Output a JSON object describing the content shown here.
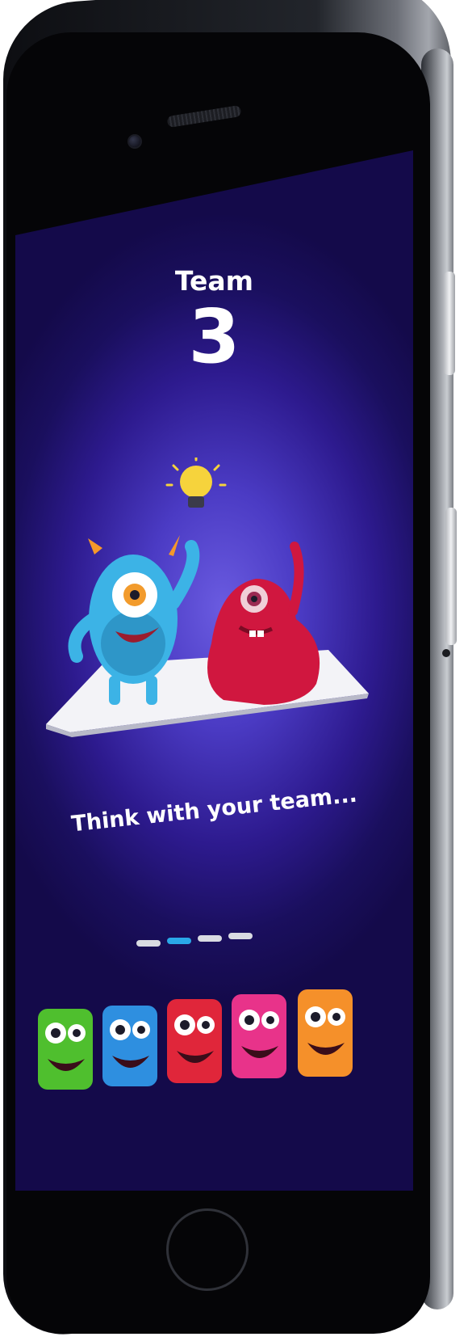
{
  "screen": {
    "team_label": "Team",
    "team_number": "3",
    "caption": "Think with your team...",
    "illustration_icon": "lightbulb-icon"
  },
  "pager": {
    "page_count": 4,
    "active_index": 1,
    "active_color": "#2aa8e8",
    "inactive_color": "#d9dbe2"
  },
  "avatars": [
    {
      "name": "green-monster",
      "color": "#4fbf2e"
    },
    {
      "name": "blue-monster",
      "color": "#2e8fe0"
    },
    {
      "name": "red-monster",
      "color": "#e0263a"
    },
    {
      "name": "pink-monster",
      "color": "#e8338a"
    },
    {
      "name": "orange-monster",
      "color": "#f5902a"
    }
  ],
  "colors": {
    "background_center": "#6a5be0",
    "background_edge": "#140a4a",
    "text": "#ffffff"
  }
}
